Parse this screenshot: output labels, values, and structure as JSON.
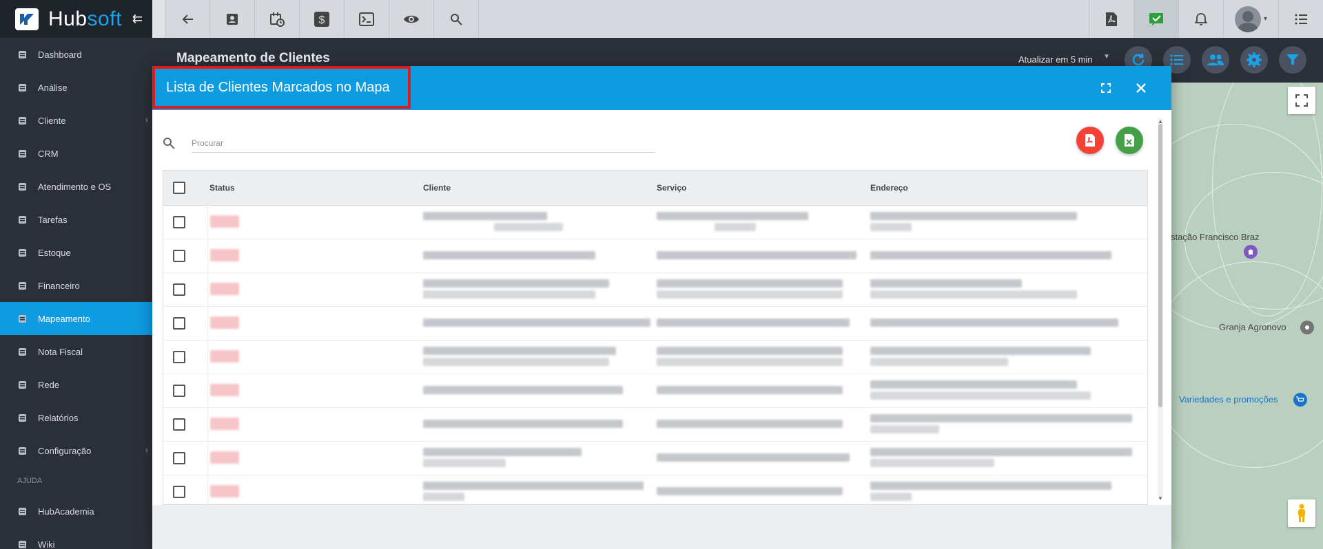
{
  "brand": {
    "name_part1": "Hub",
    "name_part2": "soft"
  },
  "sidebar": {
    "items": [
      {
        "label": "Dashboard",
        "icon": "dashboard-icon"
      },
      {
        "label": "Análise",
        "icon": "chart-pie-icon"
      },
      {
        "label": "Cliente",
        "icon": "contact-card-icon",
        "has_children": true
      },
      {
        "label": "CRM",
        "icon": "crm-icon"
      },
      {
        "label": "Atendimento e OS",
        "icon": "calendar-clock-icon"
      },
      {
        "label": "Tarefas",
        "icon": "calendar-icon"
      },
      {
        "label": "Estoque",
        "icon": "box-icon"
      },
      {
        "label": "Financeiro",
        "icon": "coins-icon"
      },
      {
        "label": "Mapeamento",
        "icon": "map-pin-icon",
        "active": true
      },
      {
        "label": "Nota Fiscal",
        "icon": "invoice-icon"
      },
      {
        "label": "Rede",
        "icon": "server-icon"
      },
      {
        "label": "Relatórios",
        "icon": "report-icon"
      },
      {
        "label": "Configuração",
        "icon": "gear-icon",
        "has_children": true
      }
    ],
    "section_help": "AJUDA",
    "help_items": [
      {
        "label": "HubAcademia",
        "icon": "play-icon"
      },
      {
        "label": "Wiki",
        "icon": "wiki-icon"
      }
    ]
  },
  "topbar": {
    "left_icons": [
      "back-arrow-icon",
      "contact-icon",
      "calendar-clock-icon",
      "dollar-icon",
      "terminal-icon",
      "eye-icon",
      "search-icon"
    ],
    "right_icons": [
      "pdf-icon",
      "check-badge-icon",
      "bell-icon",
      "avatar",
      "menu-list-icon"
    ]
  },
  "page": {
    "title": "Mapeamento de Clientes",
    "refresh_label": "Atualizar em 5 min"
  },
  "map": {
    "labels": [
      "stação Francisco Braz",
      "Granja Agronovo",
      "Variedades e promoções"
    ]
  },
  "modal": {
    "title": "Lista de Clientes Marcados no Mapa",
    "search_placeholder": "Procurar",
    "columns": [
      "Status",
      "Cliente",
      "Serviço",
      "Endereço"
    ],
    "row_count": 9
  },
  "colors": {
    "accent": "#0e9be2",
    "sidebar_bg": "#2b2f38",
    "highlight_border": "#e01b1b",
    "pdf_button": "#f44336",
    "excel_button": "#43a047"
  }
}
